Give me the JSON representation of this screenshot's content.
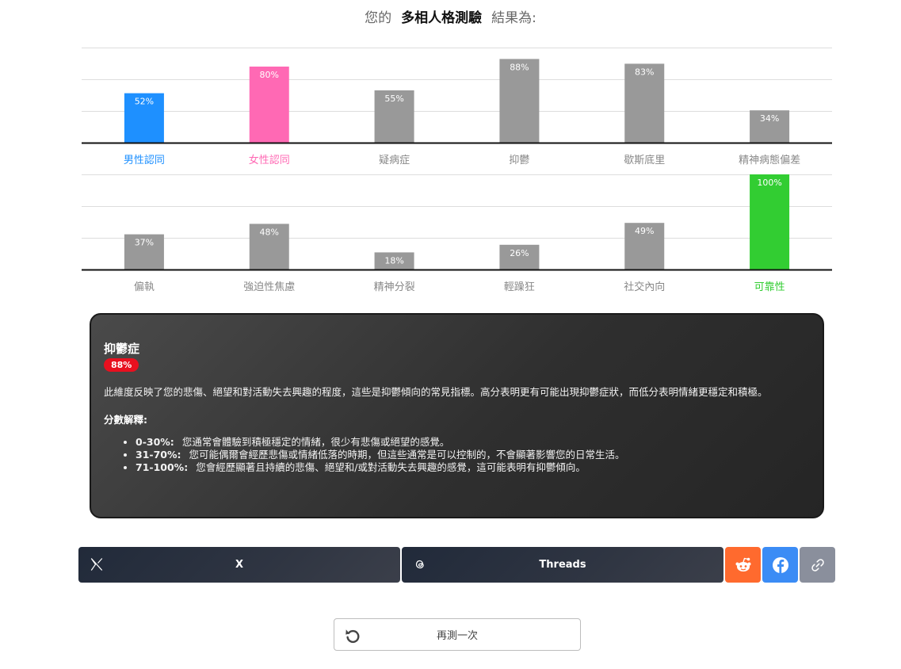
{
  "header": {
    "prefix": "您的",
    "test_name": "多相人格測驗",
    "suffix": "結果為:"
  },
  "chart_data": [
    {
      "type": "bar",
      "categories": [
        "男性認同",
        "女性認同",
        "疑病症",
        "抑鬱",
        "歇斯底里",
        "精神病態偏差"
      ],
      "values": [
        52,
        80,
        55,
        88,
        83,
        34
      ],
      "labels": [
        "52%",
        "80%",
        "55%",
        "88%",
        "83%",
        "34%"
      ],
      "colors": [
        "#1e90ff",
        "#ff69b4",
        "#999999",
        "#999999",
        "#999999",
        "#999999"
      ],
      "label_colors": [
        "#1e90ff",
        "#ff69b4",
        "#888888",
        "#888888",
        "#888888",
        "#888888"
      ],
      "ylim": [
        0,
        100
      ],
      "grid": true
    },
    {
      "type": "bar",
      "categories": [
        "偏執",
        "強迫性焦慮",
        "精神分裂",
        "輕躁狂",
        "社交內向",
        "可靠性"
      ],
      "values": [
        37,
        48,
        18,
        26,
        49,
        100
      ],
      "labels": [
        "37%",
        "48%",
        "18%",
        "26%",
        "49%",
        "100%"
      ],
      "colors": [
        "#999999",
        "#999999",
        "#999999",
        "#999999",
        "#999999",
        "#32cd32"
      ],
      "label_colors": [
        "#888888",
        "#888888",
        "#888888",
        "#888888",
        "#888888",
        "#32cd32"
      ],
      "ylim": [
        0,
        100
      ],
      "grid": true
    }
  ],
  "detail": {
    "title": "抑鬱症",
    "score": "88%",
    "description": "此維度反映了您的悲傷、絕望和對活動失去興趣的程度，這些是抑鬱傾向的常見指標。高分表明更有可能出現抑鬱症狀，而低分表明情緒更穩定和積極。",
    "interpretation_label": "分數解釋:",
    "ranges": [
      {
        "range": "0-30%:",
        "text": "您通常會體驗到積極穩定的情緒，很少有悲傷或絕望的感覺。"
      },
      {
        "range": "31-70%:",
        "text": "您可能偶爾會經歷悲傷或情緒低落的時期，但這些通常是可以控制的，不會顯著影響您的日常生活。"
      },
      {
        "range": "71-100%:",
        "text": "您會經歷顯著且持續的悲傷、絕望和/或對活動失去興趣的感覺，這可能表明有抑鬱傾向。"
      }
    ]
  },
  "share": {
    "x_label": "X",
    "threads_label": "Threads",
    "colors": {
      "reddit": "#ff6a2e",
      "facebook": "#3b8cf5",
      "link": "#8a8f9c"
    }
  },
  "retry": {
    "label": "再測一次"
  }
}
